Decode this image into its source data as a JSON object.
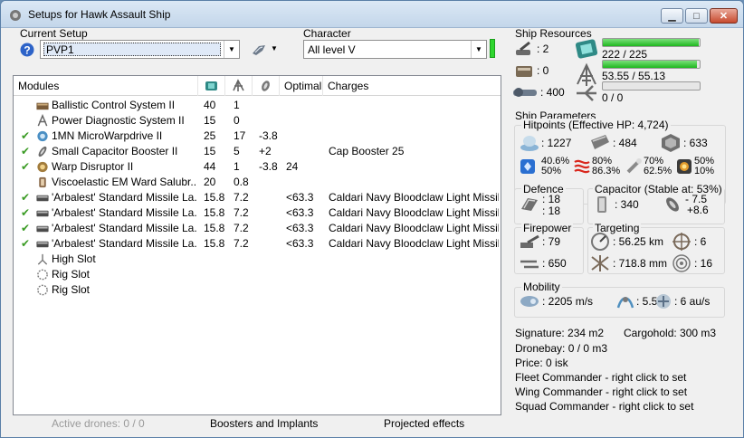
{
  "window": {
    "title": "Setups for Hawk Assault Ship",
    "buttons": {
      "minimize": "▁",
      "maximize": "□",
      "close": "✕"
    }
  },
  "setup": {
    "label": "Current Setup",
    "value": "PVP1"
  },
  "character": {
    "label": "Character",
    "value": "All level V"
  },
  "modules": {
    "headers": {
      "modules": "Modules",
      "optimal": "Optimal",
      "charges": "Charges"
    },
    "rows": [
      {
        "checked": false,
        "icon": "ballistic-control-icon",
        "name": "Ballistic Control System II",
        "cpu": "40",
        "pg": "1",
        "cap": "",
        "optimal": "",
        "charges": ""
      },
      {
        "checked": false,
        "icon": "power-diagnostic-icon",
        "name": "Power Diagnostic System II",
        "cpu": "15",
        "pg": "0",
        "cap": "",
        "optimal": "",
        "charges": ""
      },
      {
        "checked": true,
        "icon": "microwarpdrive-icon",
        "name": "1MN MicroWarpdrive II",
        "cpu": "25",
        "pg": "17",
        "cap": "-3.8",
        "optimal": "",
        "charges": ""
      },
      {
        "checked": true,
        "icon": "capacitor-booster-icon",
        "name": "Small Capacitor Booster II",
        "cpu": "15",
        "pg": "5",
        "cap": "+2",
        "optimal": "",
        "charges": "Cap Booster 25"
      },
      {
        "checked": true,
        "icon": "warp-disruptor-icon",
        "name": "Warp Disruptor II",
        "cpu": "44",
        "pg": "1",
        "cap": "-3.8",
        "optimal": "24",
        "charges": ""
      },
      {
        "checked": false,
        "icon": "em-ward-icon",
        "name": "Viscoelastic EM Ward Salubr...",
        "cpu": "20",
        "pg": "0.8",
        "cap": "",
        "optimal": "",
        "charges": ""
      },
      {
        "checked": true,
        "icon": "missile-launcher-icon",
        "name": "'Arbalest' Standard Missile La...",
        "cpu": "15.8",
        "pg": "7.2",
        "cap": "",
        "optimal": "<63.3",
        "charges": "Caldari Navy Bloodclaw Light Missile"
      },
      {
        "checked": true,
        "icon": "missile-launcher-icon",
        "name": "'Arbalest' Standard Missile La...",
        "cpu": "15.8",
        "pg": "7.2",
        "cap": "",
        "optimal": "<63.3",
        "charges": "Caldari Navy Bloodclaw Light Missile"
      },
      {
        "checked": true,
        "icon": "missile-launcher-icon",
        "name": "'Arbalest' Standard Missile La...",
        "cpu": "15.8",
        "pg": "7.2",
        "cap": "",
        "optimal": "<63.3",
        "charges": "Caldari Navy Bloodclaw Light Missile"
      },
      {
        "checked": true,
        "icon": "missile-launcher-icon",
        "name": "'Arbalest' Standard Missile La...",
        "cpu": "15.8",
        "pg": "7.2",
        "cap": "",
        "optimal": "<63.3",
        "charges": "Caldari Navy Bloodclaw Light Missile"
      },
      {
        "checked": false,
        "icon": "high-slot-icon",
        "name": "High Slot",
        "cpu": "",
        "pg": "",
        "cap": "",
        "optimal": "",
        "charges": ""
      },
      {
        "checked": false,
        "icon": "rig-slot-icon",
        "name": "Rig Slot",
        "cpu": "",
        "pg": "",
        "cap": "",
        "optimal": "",
        "charges": ""
      },
      {
        "checked": false,
        "icon": "rig-slot-icon",
        "name": "Rig Slot",
        "cpu": "",
        "pg": "",
        "cap": "",
        "optimal": "",
        "charges": ""
      }
    ]
  },
  "bottom": {
    "drones": "Active drones: 0 / 0",
    "boosters": "Boosters and Implants",
    "projected": "Projected effects"
  },
  "resources": {
    "title": "Ship Resources",
    "turret_slots": ": 2",
    "launcher_slots": ": 0",
    "calibration": ": 400",
    "cpu": "222 / 225",
    "cpu_fraction": 0.987,
    "powergrid": "53.55 / 55.13",
    "powergrid_fraction": 0.971,
    "drone_bandwidth": "0 / 0",
    "drone_fraction": 0
  },
  "params": {
    "title": "Ship Parameters",
    "hitpoints_title": "Hitpoints (Effective HP: 4,724)",
    "shield_hp": ": 1227",
    "armor_hp": ": 484",
    "structure_hp": ": 633",
    "resists": [
      {
        "top": "40.6%",
        "bottom": "50%"
      },
      {
        "top": "80%",
        "bottom": "86.3%"
      },
      {
        "top": "70%",
        "bottom": "62.5%"
      },
      {
        "top": "50%",
        "bottom": "10%"
      }
    ],
    "defence_title": "Defence",
    "defence_a": ": 18",
    "defence_b": ": 18",
    "capacitor_title": "Capacitor (Stable at: 53%)",
    "capacitor": ": 340",
    "cap_use": "- 7.5",
    "cap_gain": "+8.6",
    "firepower_title": "Firepower",
    "firepower_a": ": 79",
    "firepower_b": ": 650",
    "targeting_title": "Targeting",
    "target_range": ": 56.25 km",
    "max_targets": ": 6",
    "scan_res": ": 718.8 mm",
    "sensor": ": 16",
    "mobility_title": "Mobility",
    "speed": ": 2205 m/s",
    "align": ": 5.5 s",
    "warp": ": 6 au/s",
    "signature": "Signature: 234 m2",
    "cargohold": "Cargohold: 300 m3",
    "dronebay": "Dronebay: 0 / 0 m3",
    "price": "Price: 0 isk",
    "fleet": "Fleet Commander - right click to set",
    "wing": "Wing Commander - right click to set",
    "squad": "Squad Commander - right click to set"
  }
}
